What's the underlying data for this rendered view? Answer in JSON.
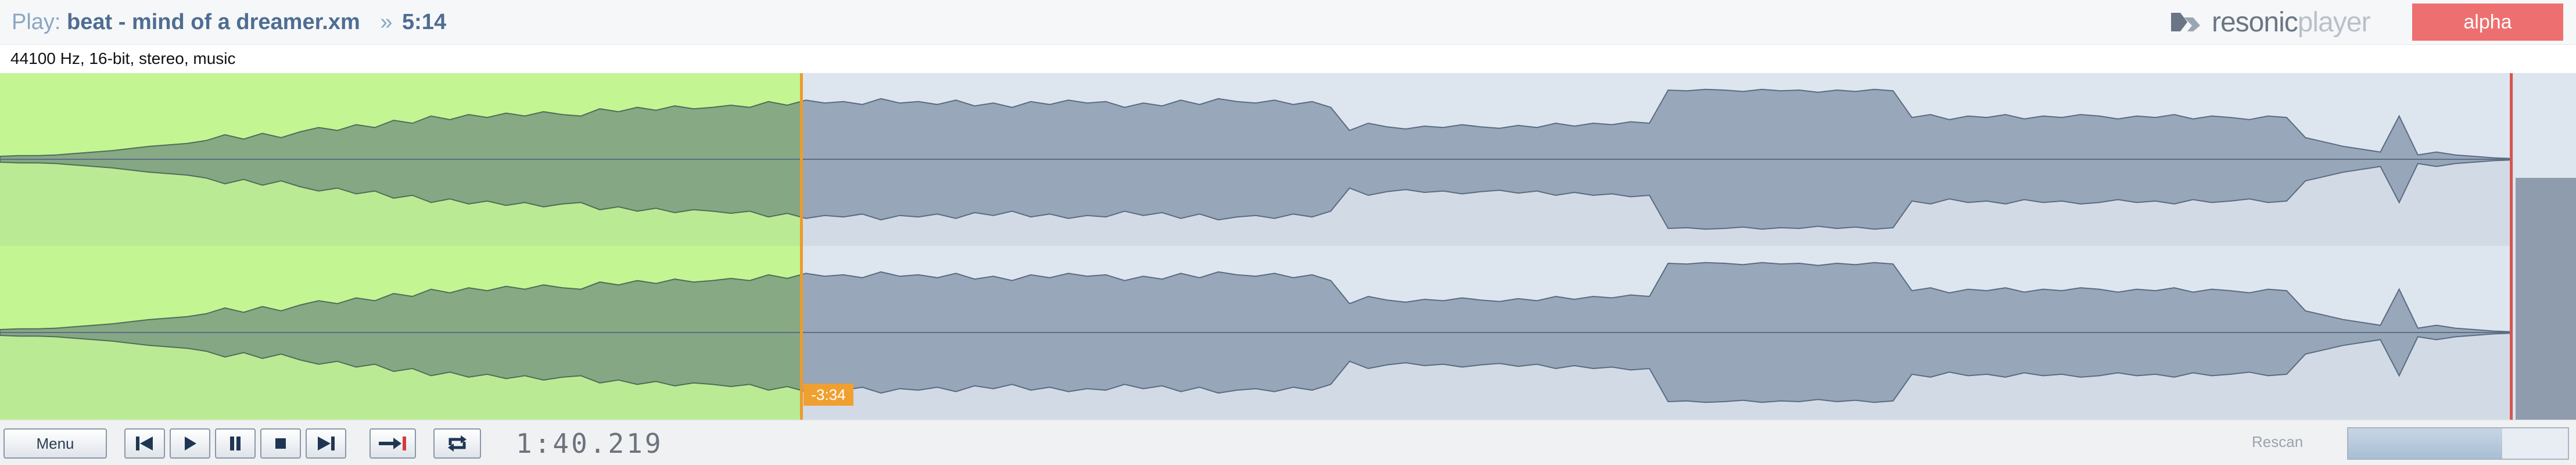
{
  "header": {
    "play_prefix": "Play:",
    "track_name": "beat - mind of a dreamer.xm",
    "duration_prefix": "»",
    "duration": "5:14",
    "logo_text_a": "resonic",
    "logo_text_b": "player",
    "badge": "alpha"
  },
  "info": {
    "audio_format": "44100 Hz, 16-bit, stereo, music"
  },
  "waveform": {
    "played_fraction": 0.311,
    "position_tag": "-3:34",
    "colors": {
      "played_background": "#c3f593",
      "played_wave": "#7d9b81",
      "unplayed_background": "#dde5ee",
      "unplayed_wave": "#8d9cb0",
      "playhead": "#ee9b2a",
      "end_marker": "#d9534f"
    },
    "envelope": [
      0.04,
      0.05,
      0.05,
      0.06,
      0.08,
      0.1,
      0.12,
      0.15,
      0.18,
      0.2,
      0.22,
      0.26,
      0.34,
      0.28,
      0.36,
      0.3,
      0.38,
      0.44,
      0.4,
      0.48,
      0.44,
      0.54,
      0.5,
      0.6,
      0.55,
      0.62,
      0.58,
      0.64,
      0.6,
      0.66,
      0.62,
      0.6,
      0.7,
      0.66,
      0.72,
      0.68,
      0.74,
      0.7,
      0.72,
      0.75,
      0.72,
      0.8,
      0.75,
      0.82,
      0.78,
      0.8,
      0.76,
      0.84,
      0.78,
      0.8,
      0.76,
      0.82,
      0.74,
      0.78,
      0.72,
      0.8,
      0.76,
      0.82,
      0.78,
      0.8,
      0.72,
      0.78,
      0.74,
      0.82,
      0.76,
      0.84,
      0.8,
      0.78,
      0.82,
      0.76,
      0.8,
      0.72,
      0.4,
      0.5,
      0.45,
      0.42,
      0.46,
      0.44,
      0.48,
      0.45,
      0.43,
      0.47,
      0.44,
      0.5,
      0.46,
      0.5,
      0.48,
      0.52,
      0.5,
      0.96,
      0.95,
      0.97,
      0.96,
      0.94,
      0.97,
      0.95,
      0.96,
      0.93,
      0.96,
      0.94,
      0.97,
      0.95,
      0.58,
      0.62,
      0.55,
      0.6,
      0.58,
      0.62,
      0.56,
      0.6,
      0.58,
      0.62,
      0.6,
      0.56,
      0.6,
      0.58,
      0.62,
      0.56,
      0.6,
      0.58,
      0.55,
      0.6,
      0.58,
      0.3,
      0.24,
      0.18,
      0.14,
      0.1,
      0.6,
      0.06,
      0.1,
      0.06,
      0.04,
      0.02,
      0.01
    ],
    "end_fraction": 0.975
  },
  "transport": {
    "menu_label": "Menu",
    "time": "1:40.219",
    "rescan_label": "Rescan",
    "rescan_progress": 0.7
  },
  "icons": {
    "prev": "skip-to-start-icon",
    "play": "play-icon",
    "pause": "pause-icon",
    "stop": "stop-icon",
    "next": "skip-to-end-icon",
    "goto": "jump-to-marker-icon",
    "loop": "loop-icon"
  }
}
